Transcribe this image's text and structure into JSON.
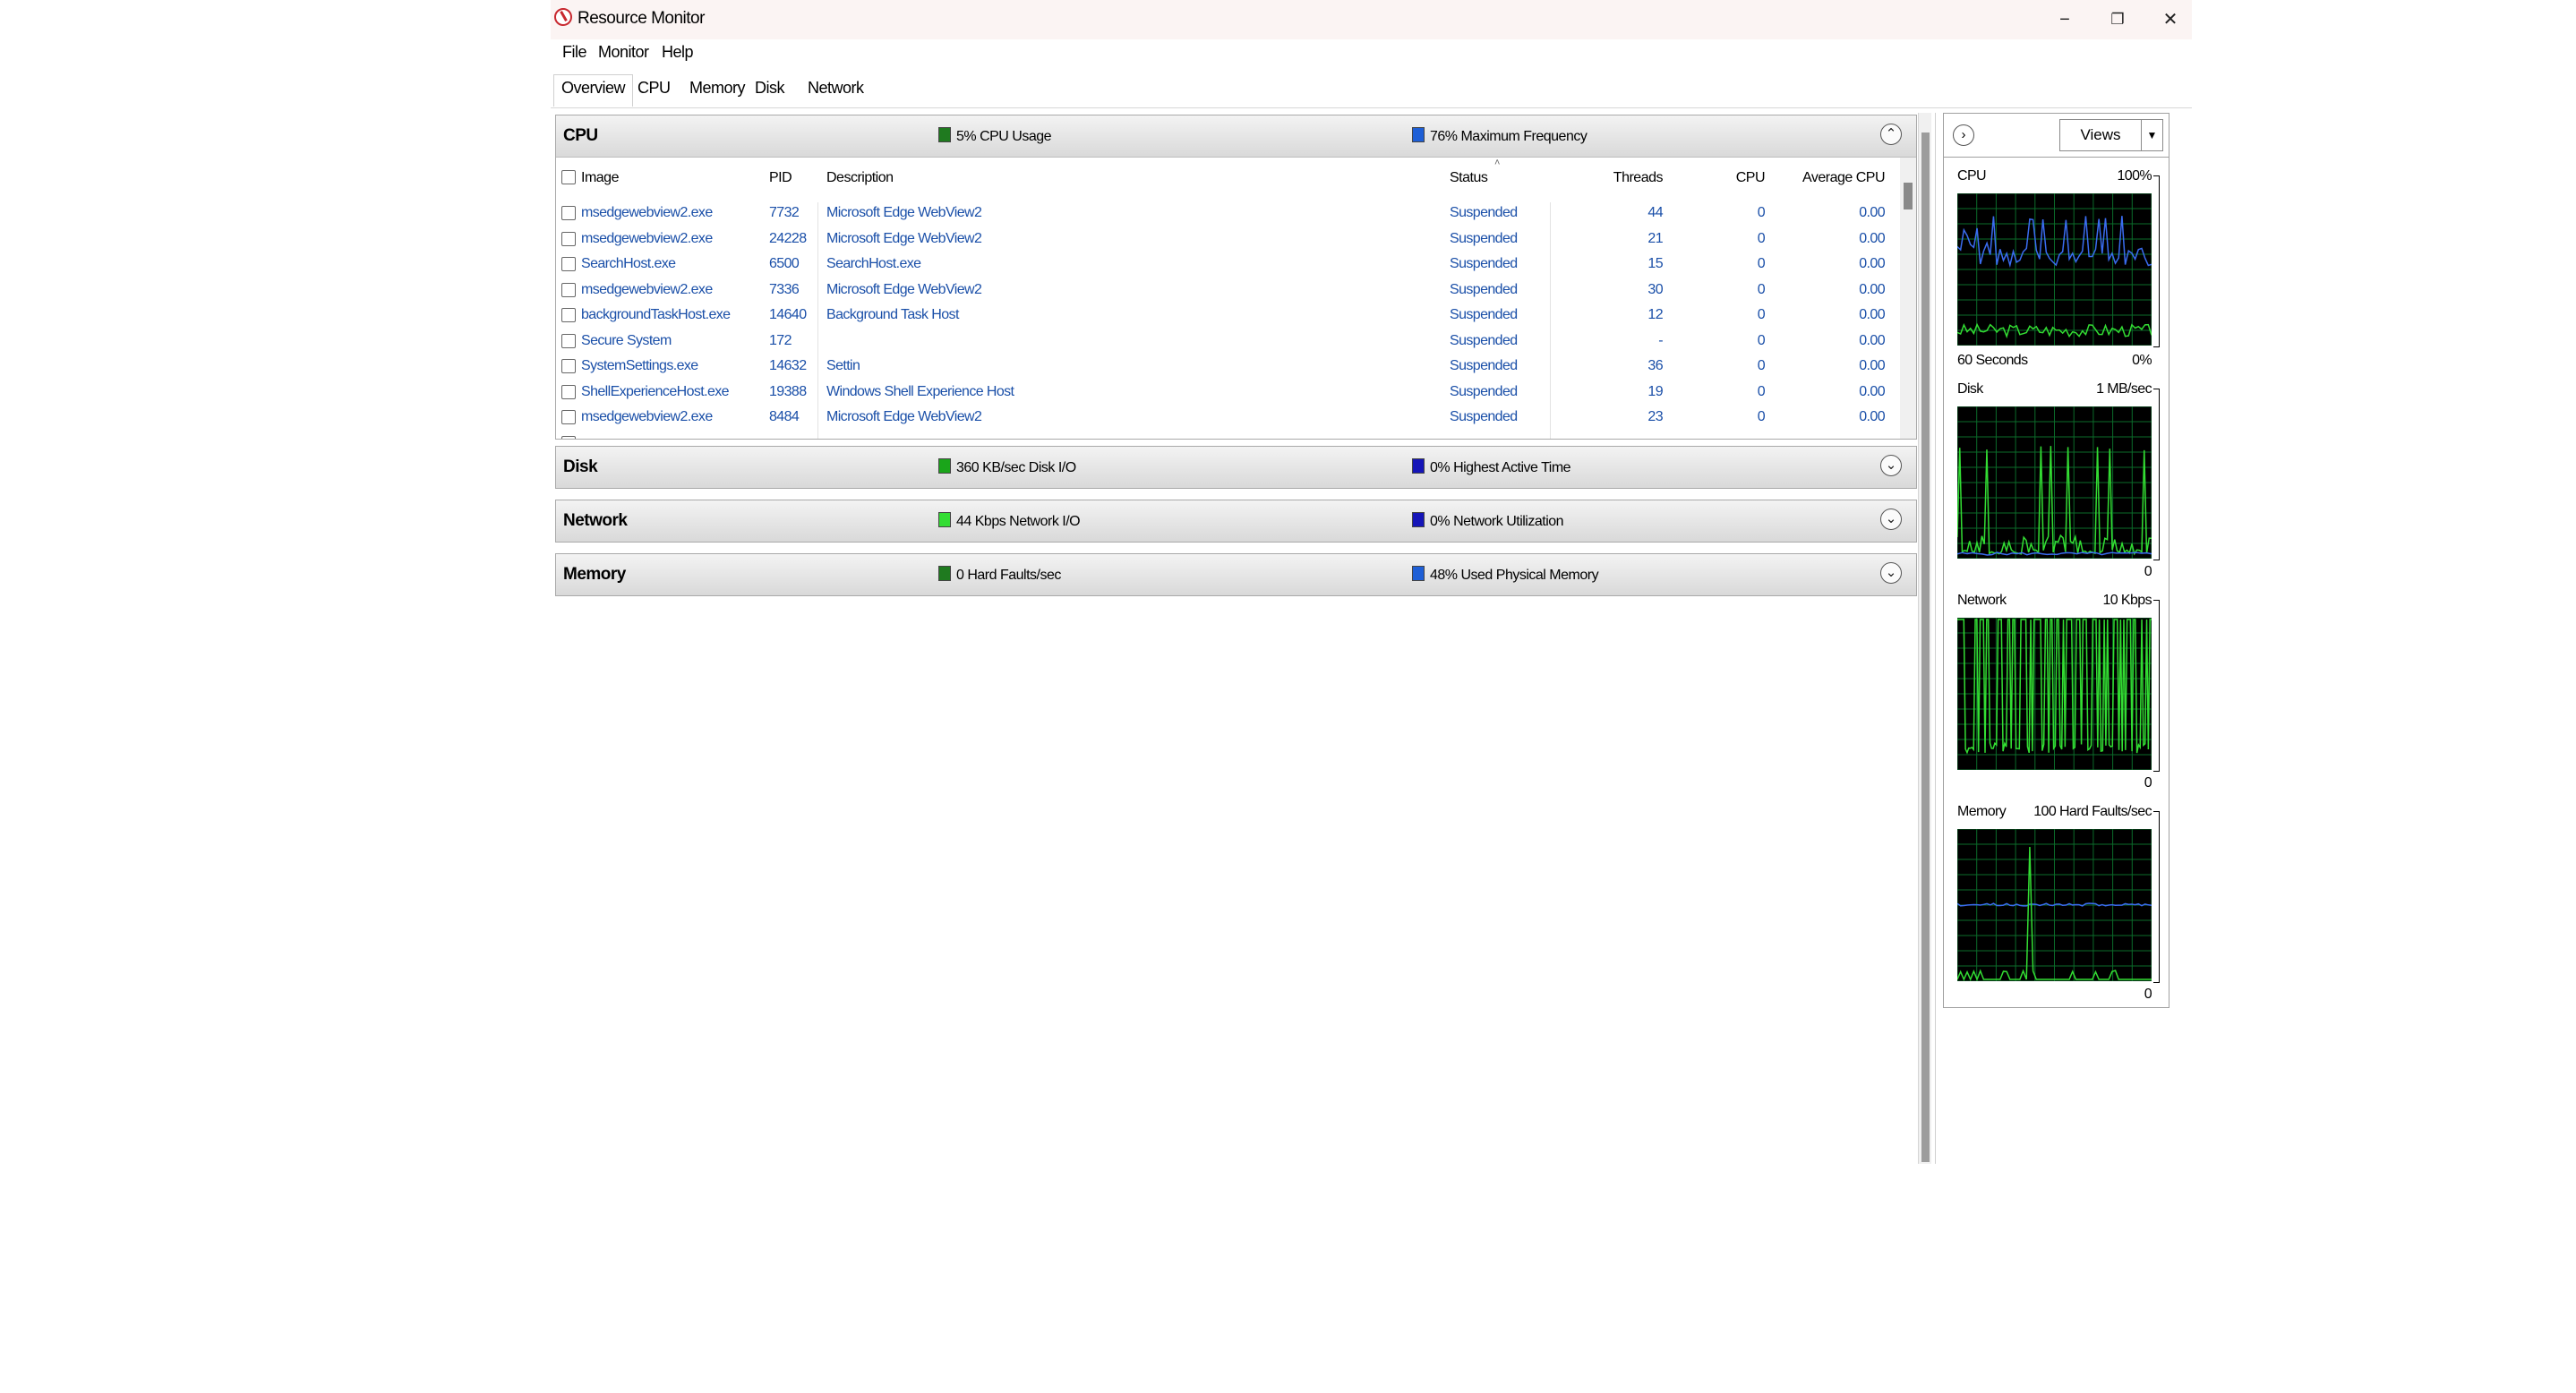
{
  "window": {
    "title": "Resource Monitor",
    "controls": {
      "minimize": "−",
      "restore": "❐",
      "close": "✕"
    }
  },
  "menu": [
    "File",
    "Monitor",
    "Help"
  ],
  "tabs": [
    "Overview",
    "CPU",
    "Memory",
    "Disk",
    "Network"
  ],
  "active_tab": "Overview",
  "cpu": {
    "title": "CPU",
    "stat1": "5% CPU Usage",
    "stat1_color": "#1f7a1f",
    "stat2": "76% Maximum Frequency",
    "stat2_color": "#1e5fd6",
    "expanded": true,
    "columns": [
      "Image",
      "PID",
      "Description",
      "Status",
      "Threads",
      "CPU",
      "Average CPU"
    ],
    "rows": [
      {
        "image": "msedgewebview2.exe",
        "pid": "7732",
        "description": "Microsoft Edge WebView2",
        "status": "Suspended",
        "threads": "44",
        "cpu": "0",
        "avg": "0.00"
      },
      {
        "image": "msedgewebview2.exe",
        "pid": "24228",
        "description": "Microsoft Edge WebView2",
        "status": "Suspended",
        "threads": "21",
        "cpu": "0",
        "avg": "0.00"
      },
      {
        "image": "SearchHost.exe",
        "pid": "6500",
        "description": "SearchHost.exe",
        "status": "Suspended",
        "threads": "15",
        "cpu": "0",
        "avg": "0.00"
      },
      {
        "image": "msedgewebview2.exe",
        "pid": "7336",
        "description": "Microsoft Edge WebView2",
        "status": "Suspended",
        "threads": "30",
        "cpu": "0",
        "avg": "0.00"
      },
      {
        "image": "backgroundTaskHost.exe",
        "pid": "14640",
        "description": "Background Task Host",
        "status": "Suspended",
        "threads": "12",
        "cpu": "0",
        "avg": "0.00"
      },
      {
        "image": "Secure System",
        "pid": "172",
        "description": "",
        "status": "Suspended",
        "threads": "-",
        "cpu": "0",
        "avg": "0.00"
      },
      {
        "image": "SystemSettings.exe",
        "pid": "14632",
        "description": "Settin",
        "status": "Suspended",
        "threads": "36",
        "cpu": "0",
        "avg": "0.00"
      },
      {
        "image": "ShellExperienceHost.exe",
        "pid": "19388",
        "description": "Windows Shell Experience Host",
        "status": "Suspended",
        "threads": "19",
        "cpu": "0",
        "avg": "0.00"
      },
      {
        "image": "msedgewebview2.exe",
        "pid": "8484",
        "description": "Microsoft Edge WebView2",
        "status": "Suspended",
        "threads": "23",
        "cpu": "0",
        "avg": "0.00"
      }
    ]
  },
  "disk": {
    "title": "Disk",
    "stat1": "360 KB/sec Disk I/O",
    "stat1_color": "#1aa51a",
    "stat2": "0% Highest Active Time",
    "stat2_color": "#1515b8"
  },
  "network": {
    "title": "Network",
    "stat1": "44 Kbps Network I/O",
    "stat1_color": "#33dd33",
    "stat2": "0% Network Utilization",
    "stat2_color": "#1515b8"
  },
  "memory": {
    "title": "Memory",
    "stat1": "0 Hard Faults/sec",
    "stat1_color": "#1f7a1f",
    "stat2": "48% Used Physical Memory",
    "stat2_color": "#1e5fd6"
  },
  "right_pane": {
    "views_label": "Views",
    "graphs": {
      "cpu": {
        "name": "CPU",
        "max": "100%",
        "footer_left": "60 Seconds",
        "footer_right": "0%"
      },
      "disk": {
        "name": "Disk",
        "max": "1 MB/sec",
        "min": "0"
      },
      "network": {
        "name": "Network",
        "max": "10 Kbps",
        "min": "0"
      },
      "memory": {
        "name": "Memory",
        "max": "100 Hard Faults/sec",
        "min": "0"
      }
    }
  }
}
